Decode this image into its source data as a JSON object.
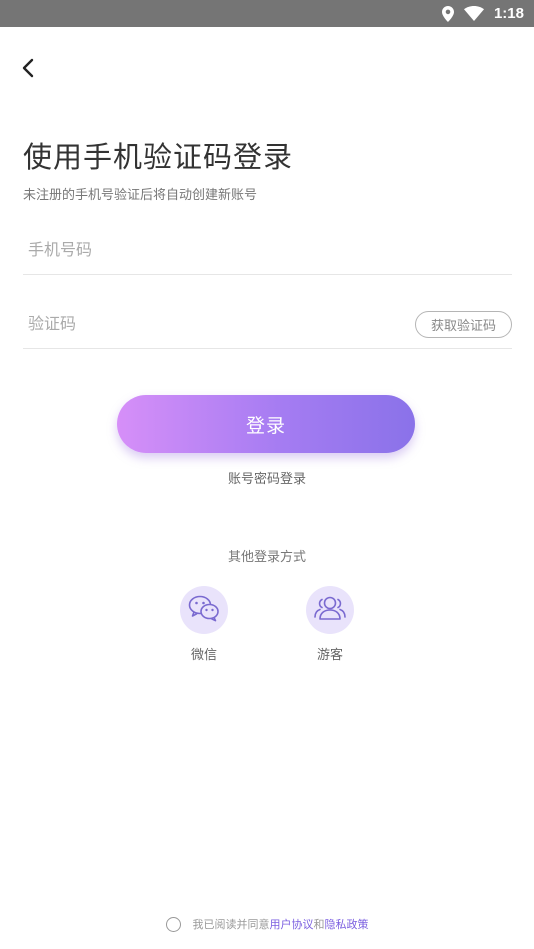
{
  "status_bar": {
    "time": "1:18",
    "icons": [
      "location-icon",
      "wifi-icon"
    ]
  },
  "header": {
    "back_icon": "chevron-left-icon"
  },
  "page": {
    "title": "使用手机验证码登录",
    "subtitle": "未注册的手机号验证后将自动创建新账号"
  },
  "form": {
    "phone_placeholder": "手机号码",
    "phone_value": "",
    "code_placeholder": "验证码",
    "code_value": "",
    "get_code_label": "获取验证码",
    "login_label": "登录",
    "password_login_label": "账号密码登录"
  },
  "other_login": {
    "title": "其他登录方式",
    "options": [
      {
        "label": "微信",
        "icon": "wechat-icon"
      },
      {
        "label": "游客",
        "icon": "guest-users-icon"
      }
    ]
  },
  "agreement": {
    "checked": false,
    "prefix": "我已阅读并同意",
    "user_agreement": "用户协议",
    "and": "和",
    "privacy_policy": "隐私政策"
  },
  "colors": {
    "accent": "#8a72e9",
    "gradient_start": "#d68ff8",
    "gradient_end": "#8a72e9",
    "icon_bg": "#e9e3fb",
    "link": "#7b5fe0",
    "status_bar": "#757575"
  }
}
